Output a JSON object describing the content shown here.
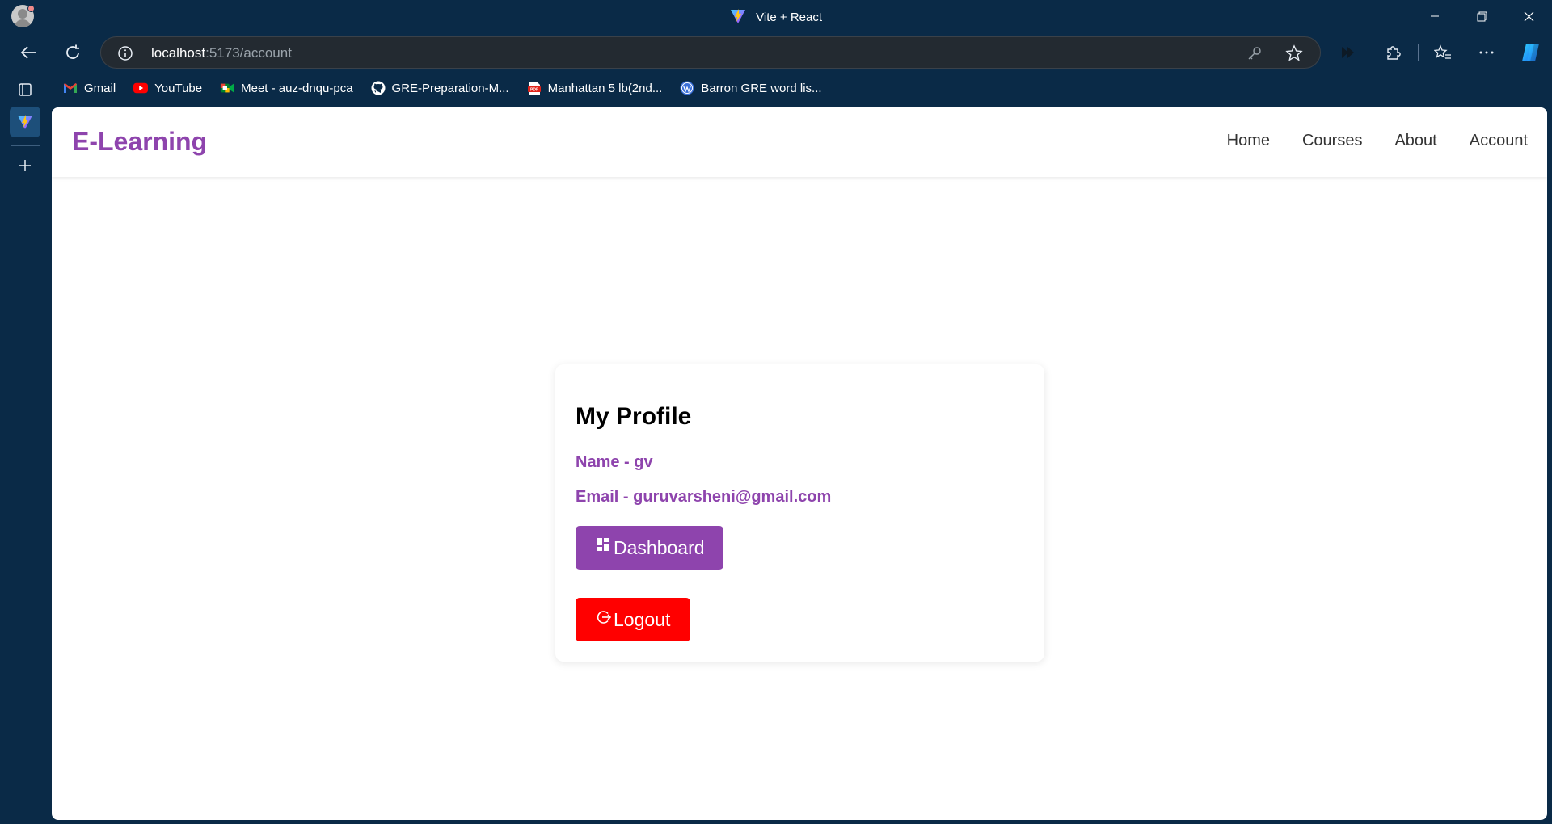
{
  "window": {
    "title": "Vite + React",
    "controls": [
      "minimize",
      "restore",
      "close"
    ]
  },
  "toolbar": {
    "url_host": "localhost",
    "url_path": ":5173/account"
  },
  "bookmarks": [
    {
      "label": "Gmail",
      "icon": "gmail-icon"
    },
    {
      "label": "YouTube",
      "icon": "youtube-icon"
    },
    {
      "label": "Meet - auz-dnqu-pca",
      "icon": "google-meet-icon"
    },
    {
      "label": "GRE-Preparation-M...",
      "icon": "github-icon"
    },
    {
      "label": "Manhattan 5 lb(2nd...",
      "icon": "pdf-icon"
    },
    {
      "label": "Barron GRE word lis...",
      "icon": "wordpress-icon"
    }
  ],
  "site": {
    "logo": "E-Learning",
    "nav": [
      "Home",
      "Courses",
      "About",
      "Account"
    ]
  },
  "profile": {
    "title": "My Profile",
    "name_line": "Name - gv",
    "email_line": "Email - guruvarsheni@gmail.com",
    "dashboard_label": "Dashboard",
    "logout_label": "Logout"
  },
  "colors": {
    "browser_frame": "#0a2a47",
    "brand_purple": "#8e44ad",
    "logout_red": "#ff0000",
    "page_bg": "#ffffff"
  }
}
